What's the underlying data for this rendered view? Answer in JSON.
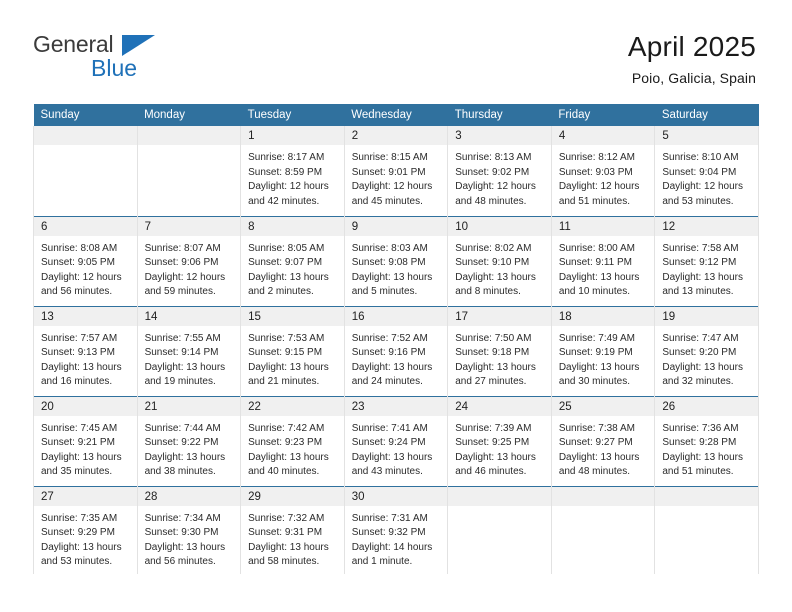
{
  "brand": {
    "name_top": "General",
    "name_bottom": "Blue",
    "triangle_color": "#1f71b8",
    "text_color": "#3b3b3b"
  },
  "header": {
    "title": "April 2025",
    "location": "Poio, Galicia, Spain"
  },
  "theme": {
    "header_row_bg": "#30719e",
    "header_row_text": "#ffffff",
    "daynum_band_bg": "#f0f0f0",
    "cell_border": "#e2e2e2",
    "week_separator": "#30719e"
  },
  "weekday_headers": [
    "Sunday",
    "Monday",
    "Tuesday",
    "Wednesday",
    "Thursday",
    "Friday",
    "Saturday"
  ],
  "weeks": [
    [
      {
        "day": "",
        "lines": []
      },
      {
        "day": "",
        "lines": []
      },
      {
        "day": "1",
        "lines": [
          "Sunrise: 8:17 AM",
          "Sunset: 8:59 PM",
          "Daylight: 12 hours",
          "and 42 minutes."
        ]
      },
      {
        "day": "2",
        "lines": [
          "Sunrise: 8:15 AM",
          "Sunset: 9:01 PM",
          "Daylight: 12 hours",
          "and 45 minutes."
        ]
      },
      {
        "day": "3",
        "lines": [
          "Sunrise: 8:13 AM",
          "Sunset: 9:02 PM",
          "Daylight: 12 hours",
          "and 48 minutes."
        ]
      },
      {
        "day": "4",
        "lines": [
          "Sunrise: 8:12 AM",
          "Sunset: 9:03 PM",
          "Daylight: 12 hours",
          "and 51 minutes."
        ]
      },
      {
        "day": "5",
        "lines": [
          "Sunrise: 8:10 AM",
          "Sunset: 9:04 PM",
          "Daylight: 12 hours",
          "and 53 minutes."
        ]
      }
    ],
    [
      {
        "day": "6",
        "lines": [
          "Sunrise: 8:08 AM",
          "Sunset: 9:05 PM",
          "Daylight: 12 hours",
          "and 56 minutes."
        ]
      },
      {
        "day": "7",
        "lines": [
          "Sunrise: 8:07 AM",
          "Sunset: 9:06 PM",
          "Daylight: 12 hours",
          "and 59 minutes."
        ]
      },
      {
        "day": "8",
        "lines": [
          "Sunrise: 8:05 AM",
          "Sunset: 9:07 PM",
          "Daylight: 13 hours",
          "and 2 minutes."
        ]
      },
      {
        "day": "9",
        "lines": [
          "Sunrise: 8:03 AM",
          "Sunset: 9:08 PM",
          "Daylight: 13 hours",
          "and 5 minutes."
        ]
      },
      {
        "day": "10",
        "lines": [
          "Sunrise: 8:02 AM",
          "Sunset: 9:10 PM",
          "Daylight: 13 hours",
          "and 8 minutes."
        ]
      },
      {
        "day": "11",
        "lines": [
          "Sunrise: 8:00 AM",
          "Sunset: 9:11 PM",
          "Daylight: 13 hours",
          "and 10 minutes."
        ]
      },
      {
        "day": "12",
        "lines": [
          "Sunrise: 7:58 AM",
          "Sunset: 9:12 PM",
          "Daylight: 13 hours",
          "and 13 minutes."
        ]
      }
    ],
    [
      {
        "day": "13",
        "lines": [
          "Sunrise: 7:57 AM",
          "Sunset: 9:13 PM",
          "Daylight: 13 hours",
          "and 16 minutes."
        ]
      },
      {
        "day": "14",
        "lines": [
          "Sunrise: 7:55 AM",
          "Sunset: 9:14 PM",
          "Daylight: 13 hours",
          "and 19 minutes."
        ]
      },
      {
        "day": "15",
        "lines": [
          "Sunrise: 7:53 AM",
          "Sunset: 9:15 PM",
          "Daylight: 13 hours",
          "and 21 minutes."
        ]
      },
      {
        "day": "16",
        "lines": [
          "Sunrise: 7:52 AM",
          "Sunset: 9:16 PM",
          "Daylight: 13 hours",
          "and 24 minutes."
        ]
      },
      {
        "day": "17",
        "lines": [
          "Sunrise: 7:50 AM",
          "Sunset: 9:18 PM",
          "Daylight: 13 hours",
          "and 27 minutes."
        ]
      },
      {
        "day": "18",
        "lines": [
          "Sunrise: 7:49 AM",
          "Sunset: 9:19 PM",
          "Daylight: 13 hours",
          "and 30 minutes."
        ]
      },
      {
        "day": "19",
        "lines": [
          "Sunrise: 7:47 AM",
          "Sunset: 9:20 PM",
          "Daylight: 13 hours",
          "and 32 minutes."
        ]
      }
    ],
    [
      {
        "day": "20",
        "lines": [
          "Sunrise: 7:45 AM",
          "Sunset: 9:21 PM",
          "Daylight: 13 hours",
          "and 35 minutes."
        ]
      },
      {
        "day": "21",
        "lines": [
          "Sunrise: 7:44 AM",
          "Sunset: 9:22 PM",
          "Daylight: 13 hours",
          "and 38 minutes."
        ]
      },
      {
        "day": "22",
        "lines": [
          "Sunrise: 7:42 AM",
          "Sunset: 9:23 PM",
          "Daylight: 13 hours",
          "and 40 minutes."
        ]
      },
      {
        "day": "23",
        "lines": [
          "Sunrise: 7:41 AM",
          "Sunset: 9:24 PM",
          "Daylight: 13 hours",
          "and 43 minutes."
        ]
      },
      {
        "day": "24",
        "lines": [
          "Sunrise: 7:39 AM",
          "Sunset: 9:25 PM",
          "Daylight: 13 hours",
          "and 46 minutes."
        ]
      },
      {
        "day": "25",
        "lines": [
          "Sunrise: 7:38 AM",
          "Sunset: 9:27 PM",
          "Daylight: 13 hours",
          "and 48 minutes."
        ]
      },
      {
        "day": "26",
        "lines": [
          "Sunrise: 7:36 AM",
          "Sunset: 9:28 PM",
          "Daylight: 13 hours",
          "and 51 minutes."
        ]
      }
    ],
    [
      {
        "day": "27",
        "lines": [
          "Sunrise: 7:35 AM",
          "Sunset: 9:29 PM",
          "Daylight: 13 hours",
          "and 53 minutes."
        ]
      },
      {
        "day": "28",
        "lines": [
          "Sunrise: 7:34 AM",
          "Sunset: 9:30 PM",
          "Daylight: 13 hours",
          "and 56 minutes."
        ]
      },
      {
        "day": "29",
        "lines": [
          "Sunrise: 7:32 AM",
          "Sunset: 9:31 PM",
          "Daylight: 13 hours",
          "and 58 minutes."
        ]
      },
      {
        "day": "30",
        "lines": [
          "Sunrise: 7:31 AM",
          "Sunset: 9:32 PM",
          "Daylight: 14 hours",
          "and 1 minute."
        ]
      },
      {
        "day": "",
        "lines": []
      },
      {
        "day": "",
        "lines": []
      },
      {
        "day": "",
        "lines": []
      }
    ]
  ]
}
